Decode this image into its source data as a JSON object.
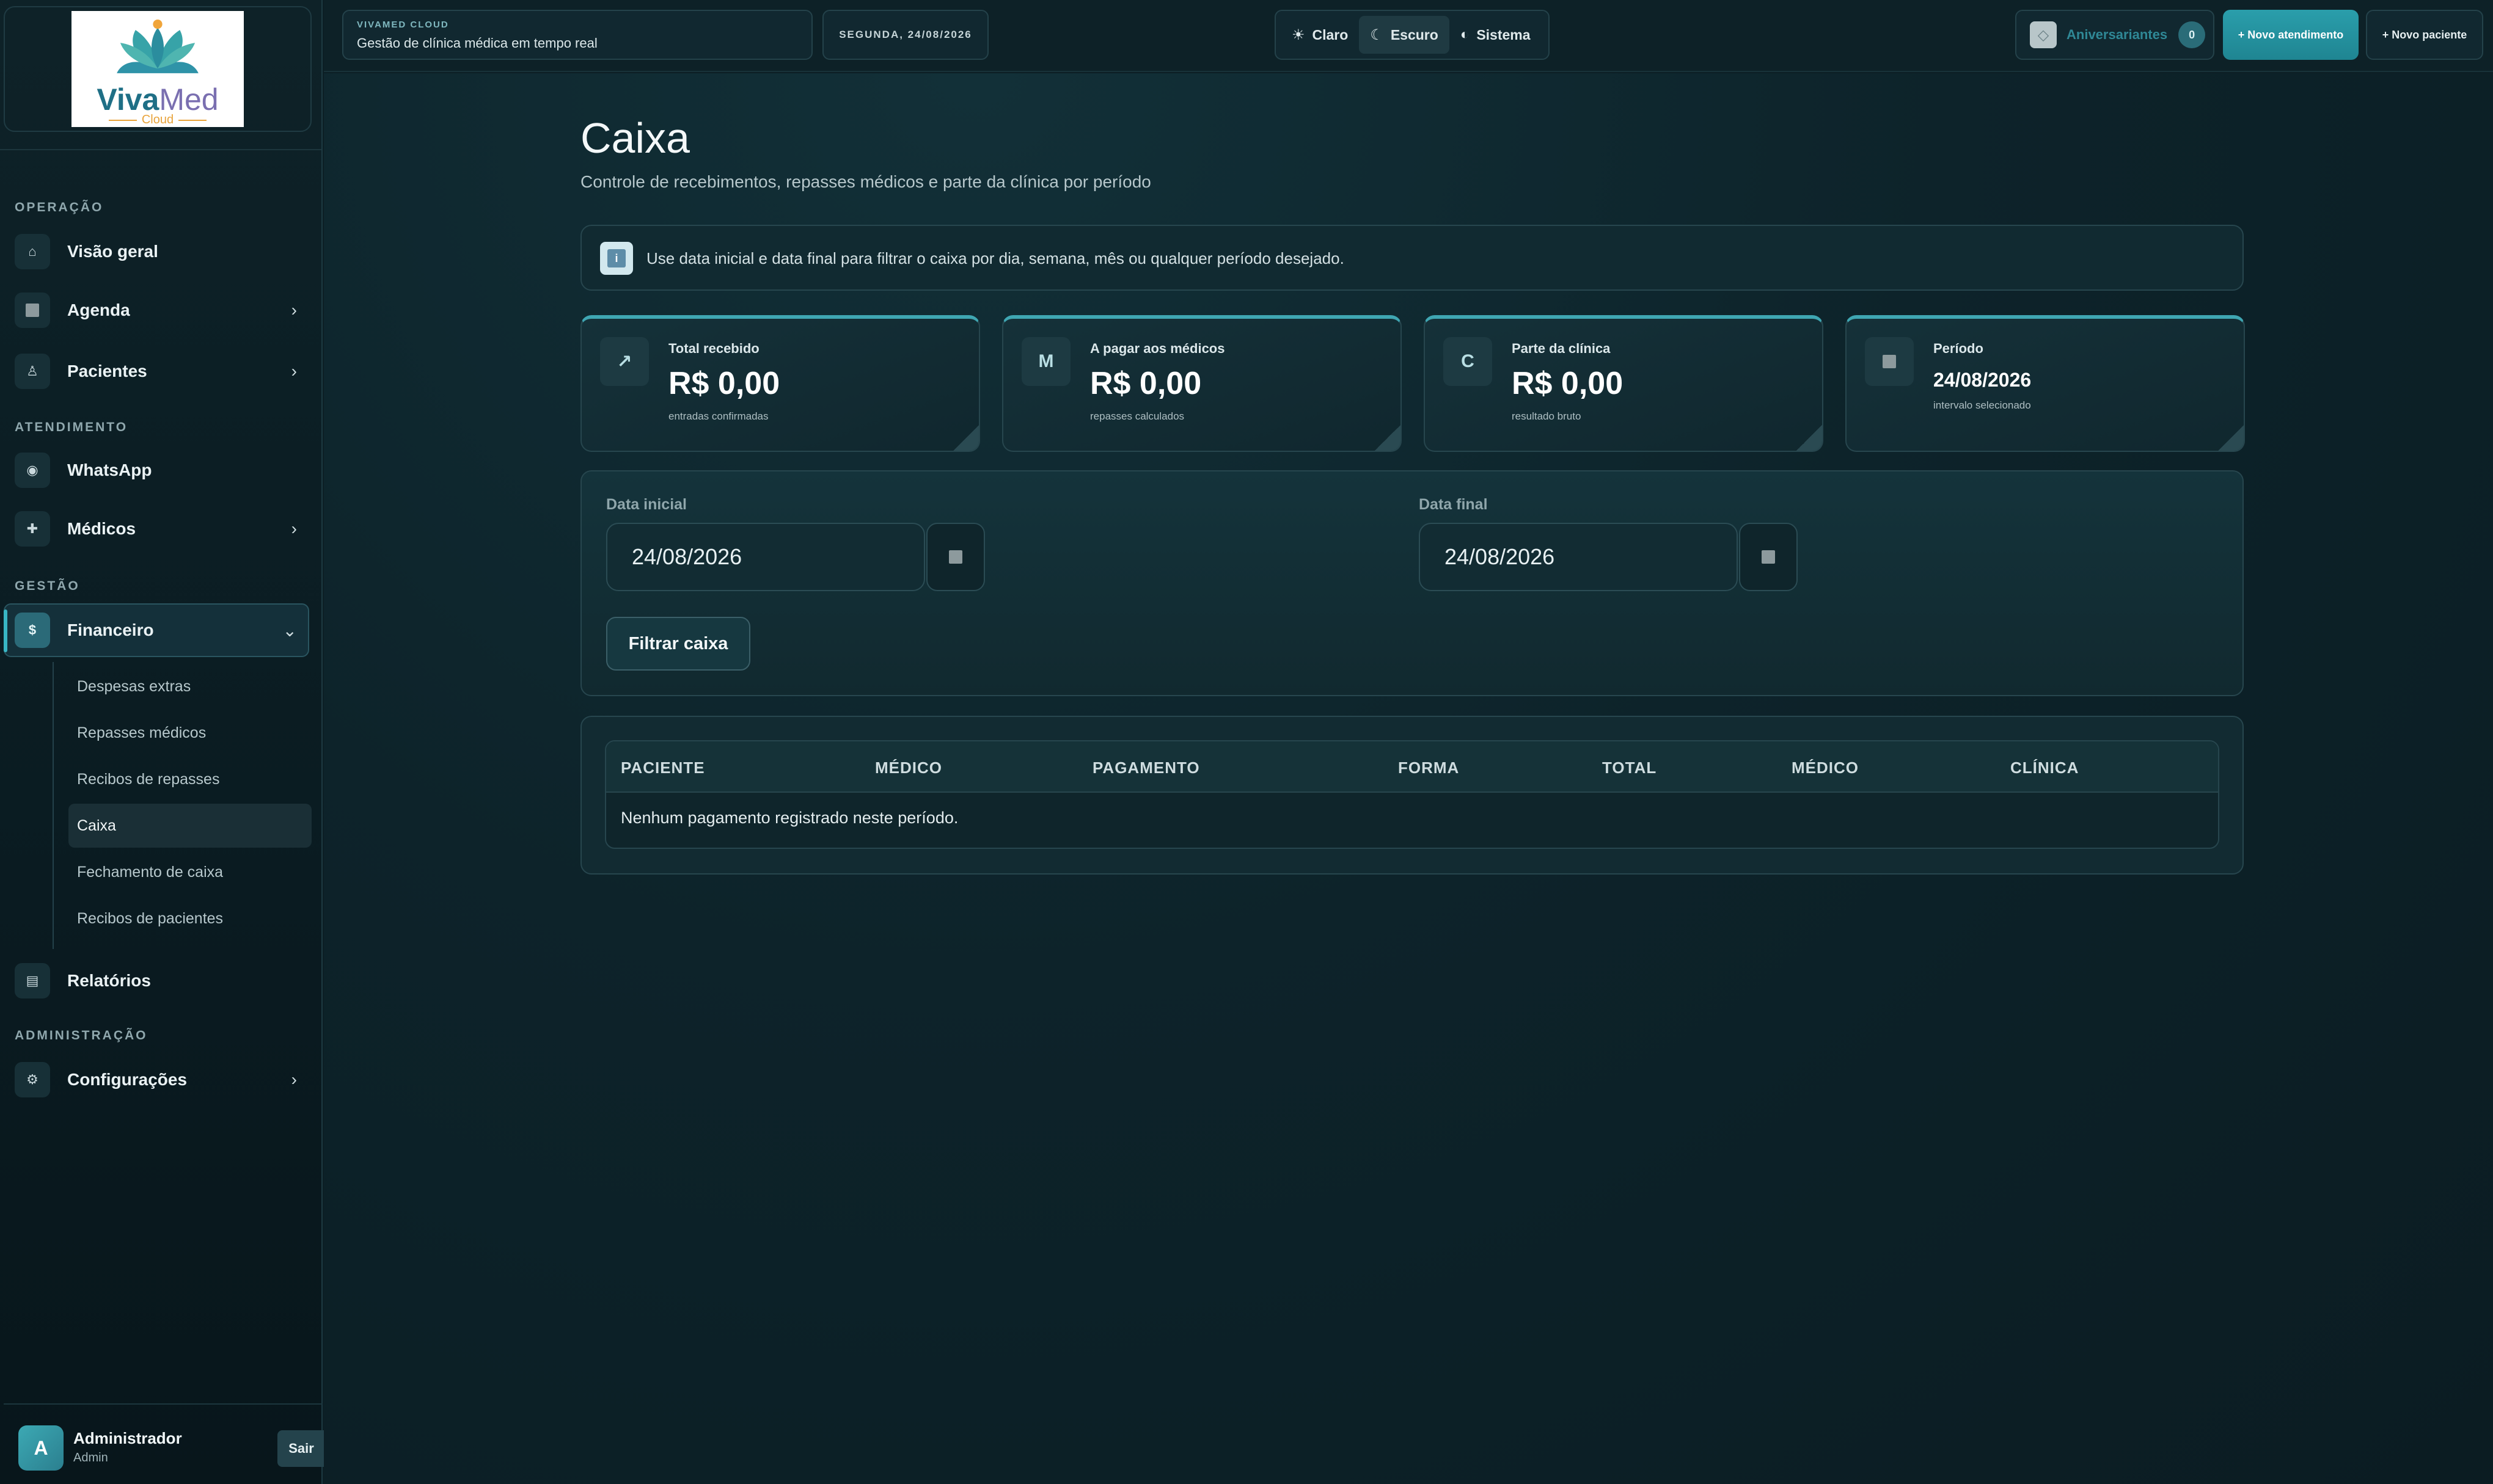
{
  "sidebar": {
    "logo": {
      "word_bold": "Viva",
      "word_light": "Med",
      "sub": "Cloud"
    },
    "sections": {
      "operacao": "OPERAÇÃO",
      "atendimento": "ATENDIMENTO",
      "gestao": "GESTÃO",
      "administracao": "ADMINISTRAÇÃO"
    },
    "items": {
      "visao_geral": "Visão geral",
      "agenda": "Agenda",
      "pacientes": "Pacientes",
      "whatsapp": "WhatsApp",
      "medicos": "Médicos",
      "financeiro": "Financeiro",
      "relatorios": "Relatórios",
      "configuracoes": "Configurações"
    },
    "financeiro_icon_text": "$",
    "submenu": [
      "Despesas extras",
      "Repasses médicos",
      "Recibos de repasses",
      "Caixa",
      "Fechamento de caixa",
      "Recibos de pacientes"
    ],
    "active_submenu": "Caixa",
    "chevron": "›",
    "chevron_open": "⌄",
    "user": {
      "initial": "A",
      "name": "Administrador",
      "role": "Admin",
      "logout": "Sair"
    }
  },
  "topbar": {
    "brand_kicker": "VIVAMED CLOUD",
    "brand_title": "Gestão de clínica médica em tempo real",
    "date": "SEGUNDA, 24/08/2026",
    "theme": {
      "light": "Claro",
      "dark": "Escuro",
      "system": "Sistema",
      "active": "Escuro"
    },
    "birthdays_label": "Aniversariantes",
    "birthdays_count": "0",
    "new_appointment": "+ Novo atendimento",
    "new_patient": "+ Novo paciente"
  },
  "page": {
    "title": "Caixa",
    "subtitle": "Controle de recebimentos, repasses médicos e parte da clínica por período",
    "info": "Use data inicial e data final para filtrar o caixa por dia, semana, mês ou qualquer período desejado."
  },
  "stats": [
    {
      "icon": "↗",
      "label": "Total recebido",
      "value": "R$ 0,00",
      "hint": "entradas confirmadas"
    },
    {
      "icon": "M",
      "label": "A pagar aos médicos",
      "value": "R$ 0,00",
      "hint": "repasses calculados"
    },
    {
      "icon": "C",
      "label": "Parte da clínica",
      "value": "R$ 0,00",
      "hint": "resultado bruto"
    },
    {
      "icon": "■",
      "label": "Período",
      "value": "24/08/2026",
      "hint": "intervalo selecionado"
    }
  ],
  "filter": {
    "start_label": "Data inicial",
    "start_value": "24/08/2026",
    "end_label": "Data final",
    "end_value": "24/08/2026",
    "button": "Filtrar caixa"
  },
  "table": {
    "columns": [
      "PACIENTE",
      "MÉDICO",
      "PAGAMENTO",
      "FORMA",
      "TOTAL",
      "MÉDICO",
      "CLÍNICA"
    ],
    "empty": "Nenhum pagamento registrado neste período."
  },
  "colors": {
    "accent": "#2a9eab",
    "background": "#0c1e24",
    "panel": "#112a31"
  }
}
